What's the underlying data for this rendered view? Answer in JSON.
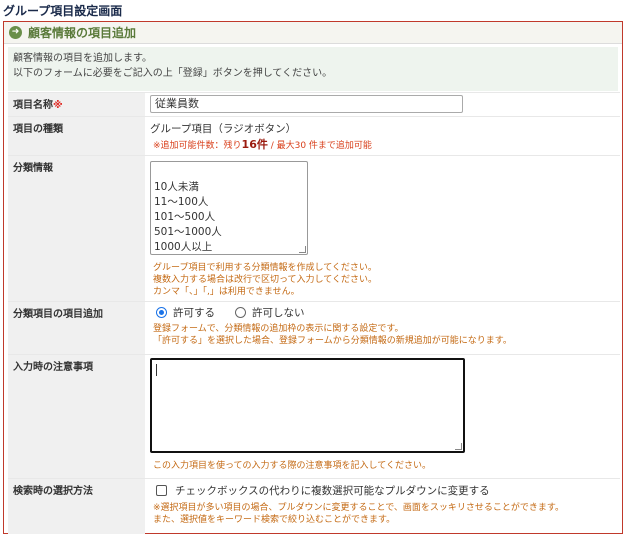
{
  "page": {
    "title": "グループ項目設定画面"
  },
  "panel": {
    "header_icon": "arrow-right-circle-icon",
    "header_title": "顧客情報の項目追加",
    "intro_line1": "顧客情報の項目を追加します。",
    "intro_line2": "以下のフォームに必要をご記入の上「登録」ボタンを押してください。"
  },
  "fields": {
    "name": {
      "label": "項目名称",
      "required_mark": "※",
      "value": "従業員数"
    },
    "type": {
      "label": "項目の種類",
      "value": "グループ項目（ラジオボタン）",
      "note_prefix": "※追加可能件数：残り",
      "note_count": "16件",
      "note_suffix": " / 最大30 件まで追加可能"
    },
    "categories": {
      "label": "分類情報",
      "value": "10人未満\n11〜100人\n101〜500人\n501〜1000人\n1000人以上",
      "note_line1": "グループ項目で利用する分類情報を作成してください。",
      "note_line2": "複数入力する場合は改行で区切って入力してください。",
      "note_line3": "カンマ「、」「,」は利用できません。"
    },
    "add_option": {
      "label": "分類項目の項目追加",
      "option_allow": "許可する",
      "option_deny": "許可しない",
      "selected": "許可する",
      "note_line1": "登録フォームで、分類情報の追加枠の表示に関する設定です。",
      "note_line2": "「許可する」を選択した場合、登録フォームから分類情報の新規追加が可能になります。"
    },
    "notes": {
      "label": "入力時の注意事項",
      "value": "",
      "note": "この入力項目を使っての入力する際の注意事項を記入してください。"
    },
    "search": {
      "label": "検索時の選択方法",
      "checkbox_label": "チェックボックスの代わりに複数選択可能なプルダウンに変更する",
      "checked": false,
      "note_line1": "※選択項目が多い項目の場合、プルダウンに変更することで、画面をスッキリさせることができます。",
      "note_line2": "また、選択値をキーワード検索で絞り込むことができます。"
    }
  },
  "colors": {
    "accent": "#6a8f4a",
    "note": "#c46a14",
    "panel_border": "#c0392b",
    "required": "#e0302a"
  }
}
